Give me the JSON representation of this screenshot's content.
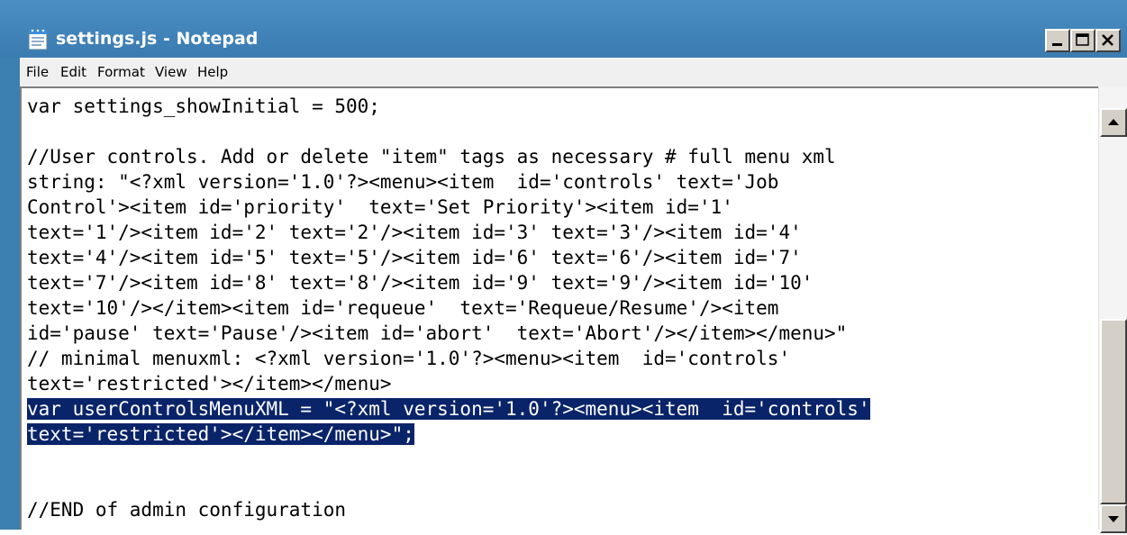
{
  "window": {
    "title": "settings.js - Notepad",
    "icon": "notepad-icon"
  },
  "controls": {
    "minimize_icon": "minimize-icon",
    "maximize_icon": "maximize-icon",
    "close_icon": "close-icon"
  },
  "menu": {
    "items": [
      "File",
      "Edit",
      "Format",
      "View",
      "Help"
    ]
  },
  "editor": {
    "lines": [
      "var settings_showInitial = 500;",
      "",
      "//User controls. Add or delete \"item\" tags as necessary # full menu xml",
      "string: \"<?xml version='1.0'?><menu><item  id='controls' text='Job",
      "Control'><item id='priority'  text='Set Priority'><item id='1'",
      "text='1'/><item id='2' text='2'/><item id='3' text='3'/><item id='4'",
      "text='4'/><item id='5' text='5'/><item id='6' text='6'/><item id='7'",
      "text='7'/><item id='8' text='8'/><item id='9' text='9'/><item id='10'",
      "text='10'/></item><item id='requeue'  text='Requeue/Resume'/><item",
      "id='pause' text='Pause'/><item id='abort'  text='Abort'/></item></menu>\"",
      "// minimal menuxml: <?xml version='1.0'?><menu><item  id='controls'",
      "text='restricted'></item></menu>",
      "var userControlsMenuXML = \"<?xml version='1.0'?><menu><item  id='controls'",
      "text='restricted'></item></menu>\";",
      "",
      "",
      "//END of admin configuration"
    ],
    "selected_line_indices": [
      12,
      13
    ]
  },
  "scrollbar": {
    "up_icon": "scroll-up-arrow-icon",
    "down_icon": "scroll-down-arrow-icon"
  },
  "colors": {
    "title_bar": "#3c7fb1",
    "selection_bg": "#0a246a",
    "selection_fg": "#ffffff"
  }
}
